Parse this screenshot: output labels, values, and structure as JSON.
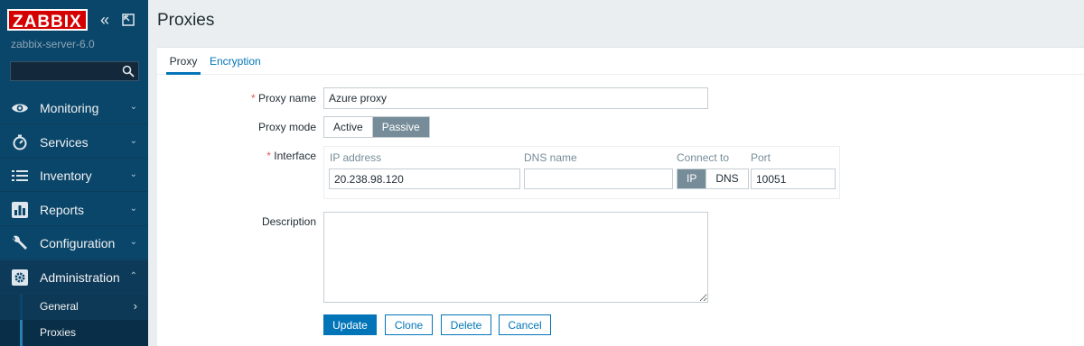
{
  "sidebar": {
    "logo": "ZABBIX",
    "server_name": "zabbix-server-6.0",
    "collapse_glyph": "«",
    "search": {
      "value": "",
      "placeholder": ""
    },
    "menu": [
      {
        "label": "Monitoring",
        "icon": "eye-icon",
        "chevron": "⌄"
      },
      {
        "label": "Services",
        "icon": "stopwatch-icon",
        "chevron": "⌄"
      },
      {
        "label": "Inventory",
        "icon": "list-icon",
        "chevron": "⌄"
      },
      {
        "label": "Reports",
        "icon": "bar-chart-icon",
        "chevron": "⌄"
      },
      {
        "label": "Configuration",
        "icon": "wrench-icon",
        "chevron": "⌄"
      },
      {
        "label": "Administration",
        "icon": "gear-icon",
        "chevron": "⌃"
      }
    ],
    "submenu": [
      {
        "label": "General",
        "chevron": "›"
      },
      {
        "label": "Proxies"
      }
    ]
  },
  "page": {
    "title": "Proxies",
    "tabs": [
      {
        "label": "Proxy"
      },
      {
        "label": "Encryption"
      }
    ]
  },
  "form": {
    "required_mark": "*",
    "proxy_name": {
      "label": "Proxy name",
      "value": "Azure proxy"
    },
    "proxy_mode": {
      "label": "Proxy mode",
      "options": [
        "Active",
        "Passive"
      ],
      "selected": "Passive"
    },
    "interface": {
      "label": "Interface",
      "headers": {
        "ip": "IP address",
        "dns": "DNS name",
        "connect": "Connect to",
        "port": "Port"
      },
      "ip_value": "20.238.98.120",
      "dns_value": "",
      "connect_options": [
        "IP",
        "DNS"
      ],
      "connect_selected": "IP",
      "port_value": "10051"
    },
    "description": {
      "label": "Description",
      "value": ""
    }
  },
  "buttons": {
    "update": "Update",
    "clone": "Clone",
    "delete": "Delete",
    "cancel": "Cancel"
  },
  "colors": {
    "sidebar_bg": "#0a466a",
    "accent": "#0275b8",
    "logo_red": "#d40000",
    "selected_toggle": "#768d99",
    "required": "#e45959"
  }
}
